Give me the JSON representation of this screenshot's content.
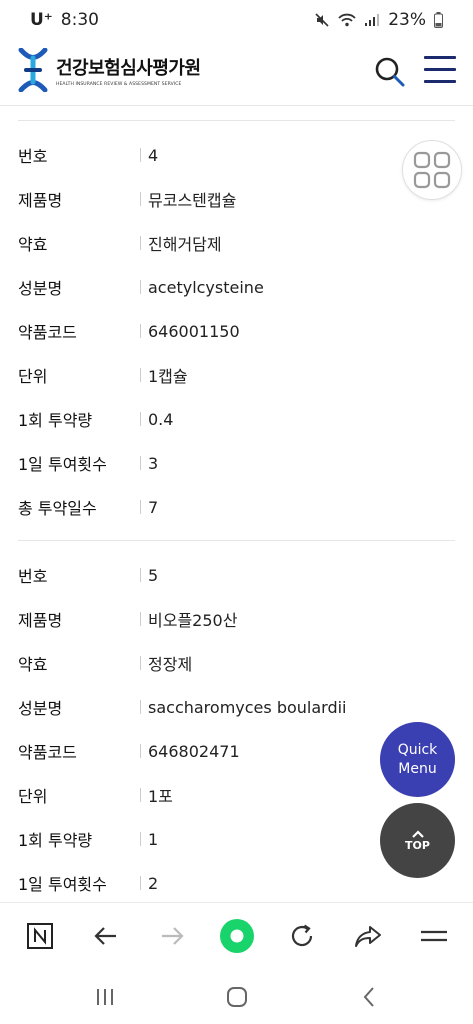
{
  "status_bar": {
    "carrier": "U⁺",
    "time": "8:30",
    "battery": "23%"
  },
  "header": {
    "logo_main": "건강보험심사평가원",
    "logo_sub": "HEALTH INSURANCE REVIEW & ASSESSMENT SERVICE"
  },
  "records": [
    {
      "fields": [
        {
          "label": "번호",
          "value": "4"
        },
        {
          "label": "제품명",
          "value": "뮤코스텐캡슐"
        },
        {
          "label": "약효",
          "value": "진해거담제"
        },
        {
          "label": "성분명",
          "value": "acetylcysteine"
        },
        {
          "label": "약품코드",
          "value": "646001150"
        },
        {
          "label": "단위",
          "value": "1캡슐"
        },
        {
          "label": "1회 투약량",
          "value": "0.4"
        },
        {
          "label": "1일 투여횟수",
          "value": "3"
        },
        {
          "label": "총 투약일수",
          "value": "7"
        }
      ]
    },
    {
      "fields": [
        {
          "label": "번호",
          "value": "5"
        },
        {
          "label": "제품명",
          "value": "비오플250산"
        },
        {
          "label": "약효",
          "value": "정장제"
        },
        {
          "label": "성분명",
          "value": "saccharomyces boulardii"
        },
        {
          "label": "약품코드",
          "value": "646802471"
        },
        {
          "label": "단위",
          "value": "1포"
        },
        {
          "label": "1회 투약량",
          "value": "1"
        },
        {
          "label": "1일 투여횟수",
          "value": "2"
        }
      ]
    }
  ],
  "floating": {
    "quick_line1": "Quick",
    "quick_line2": "Menu",
    "top_label": "TOP"
  },
  "icons": {
    "grid": "grid-icon",
    "search": "search-icon",
    "menu": "hamburger-menu-icon"
  },
  "colors": {
    "quick_menu": "#3a3fb1",
    "top_button": "#444444",
    "accent_green": "#19d36b",
    "logo_blue": "#1e5bb8"
  }
}
